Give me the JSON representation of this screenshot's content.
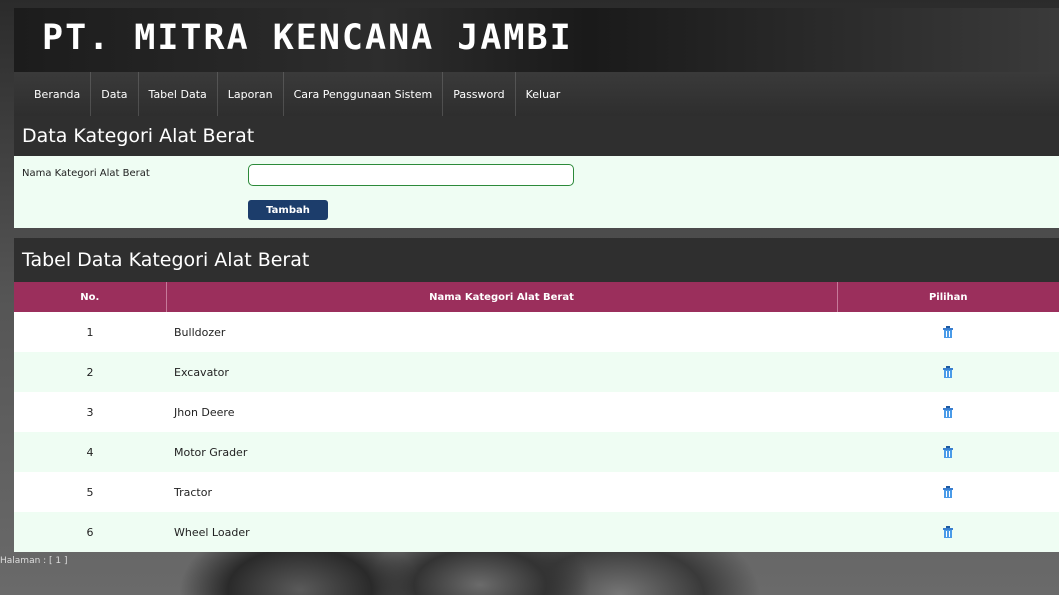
{
  "header": {
    "title": "PT. MITRA KENCANA JAMBI"
  },
  "nav": {
    "items": [
      {
        "label": "Beranda"
      },
      {
        "label": "Data"
      },
      {
        "label": "Tabel Data"
      },
      {
        "label": "Laporan"
      },
      {
        "label": "Cara Penggunaan Sistem"
      },
      {
        "label": "Password"
      },
      {
        "label": "Keluar"
      }
    ]
  },
  "form": {
    "heading": "Data Kategori Alat Berat",
    "field_label": "Nama Kategori Alat Berat",
    "field_value": "",
    "submit_label": "Tambah"
  },
  "table": {
    "heading": "Tabel Data Kategori Alat Berat",
    "columns": [
      "No.",
      "Nama Kategori Alat Berat",
      "Pilihan"
    ],
    "rows": [
      {
        "no": "1",
        "name": "Bulldozer"
      },
      {
        "no": "2",
        "name": "Excavator"
      },
      {
        "no": "3",
        "name": "Jhon Deere"
      },
      {
        "no": "4",
        "name": "Motor Grader"
      },
      {
        "no": "5",
        "name": "Tractor"
      },
      {
        "no": "6",
        "name": "Wheel Loader"
      }
    ],
    "action_icon": "trash-icon"
  },
  "pagination": {
    "text": "Halaman : [ 1 ]"
  },
  "colors": {
    "table_header": "#9b2f5c",
    "row_alt": "#effdf3",
    "button": "#1c3d6b",
    "section_bar": "#2f2f2f"
  }
}
